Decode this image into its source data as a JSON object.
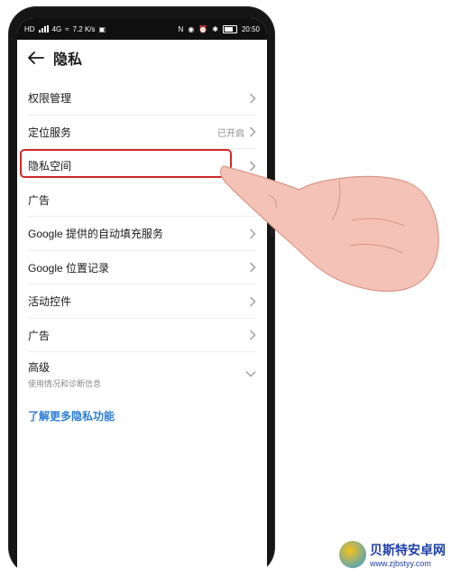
{
  "status": {
    "left_indicator": "HD",
    "network": "4G",
    "net_speed": "7.2 K/s",
    "time": "20:50"
  },
  "header": {
    "title": "隐私"
  },
  "menu": [
    {
      "label": "权限管理",
      "value": ""
    },
    {
      "label": "定位服务",
      "value": "已开启"
    },
    {
      "label": "隐私空间",
      "value": ""
    },
    {
      "label": "广告",
      "value": ""
    },
    {
      "label": "Google 提供的自动填充服务",
      "value": ""
    },
    {
      "label": "Google 位置记录",
      "value": ""
    },
    {
      "label": "活动控件",
      "value": ""
    },
    {
      "label": "广告",
      "value": ""
    }
  ],
  "advanced": {
    "label": "高级",
    "subtitle": "使用情况和诊断信息"
  },
  "link": {
    "label": "了解更多隐私功能"
  },
  "watermark": {
    "name": "贝斯特安卓网",
    "url": "www.zjbstyy.com"
  },
  "colors": {
    "accent_blue": "#2f7fd4",
    "highlight_red": "#d0292c",
    "skin": "#f4c2b6"
  }
}
